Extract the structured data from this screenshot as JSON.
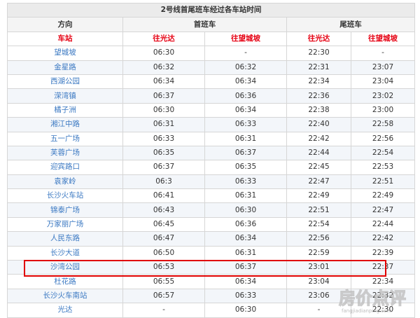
{
  "table": {
    "title": "2号线首尾班车经过各车站时间",
    "col_direction": "方向",
    "first_train": "首班车",
    "last_train": "尾班车",
    "col_station": "车站",
    "to_guangda": "往光达",
    "to_wangli": "往望城坡",
    "rows": [
      {
        "station": "望城坡",
        "first_guangda": "06:30",
        "first_wangli": "-",
        "last_guangda": "22:30",
        "last_wangli": "-"
      },
      {
        "station": "金星路",
        "first_guangda": "06:32",
        "first_wangli": "06:32",
        "last_guangda": "22:31",
        "last_wangli": "23:07"
      },
      {
        "station": "西湖公园",
        "first_guangda": "06:34",
        "first_wangli": "06:34",
        "last_guangda": "22:34",
        "last_wangli": "23:04"
      },
      {
        "station": "溁湾镇",
        "first_guangda": "06:37",
        "first_wangli": "06:36",
        "last_guangda": "22:36",
        "last_wangli": "23:02"
      },
      {
        "station": "橘子洲",
        "first_guangda": "06:30",
        "first_wangli": "06:34",
        "last_guangda": "22:38",
        "last_wangli": "23:00"
      },
      {
        "station": "湘江中路",
        "first_guangda": "06:31",
        "first_wangli": "06:33",
        "last_guangda": "22:40",
        "last_wangli": "22:58"
      },
      {
        "station": "五一广场",
        "first_guangda": "06:33",
        "first_wangli": "06:31",
        "last_guangda": "22:42",
        "last_wangli": "22:56"
      },
      {
        "station": "芙蓉广场",
        "first_guangda": "06:35",
        "first_wangli": "06:37",
        "last_guangda": "22:44",
        "last_wangli": "22:54"
      },
      {
        "station": "迎宾路口",
        "first_guangda": "06:37",
        "first_wangli": "06:35",
        "last_guangda": "22:45",
        "last_wangli": "22:53"
      },
      {
        "station": "袁家岭",
        "first_guangda": "06:3",
        "first_wangli": "06:33",
        "last_guangda": "22:47",
        "last_wangli": "22:51"
      },
      {
        "station": "长沙火车站",
        "first_guangda": "06:41",
        "first_wangli": "06:31",
        "last_guangda": "22:49",
        "last_wangli": "22:49"
      },
      {
        "station": "锦泰广场",
        "first_guangda": "06:43",
        "first_wangli": "06:30",
        "last_guangda": "22:51",
        "last_wangli": "22:47"
      },
      {
        "station": "万家丽广场",
        "first_guangda": "06:45",
        "first_wangli": "06:36",
        "last_guangda": "22:54",
        "last_wangli": "22:44"
      },
      {
        "station": "人民东路",
        "first_guangda": "06:47",
        "first_wangli": "06:34",
        "last_guangda": "22:56",
        "last_wangli": "22:42"
      },
      {
        "station": "长沙大道",
        "first_guangda": "06:50",
        "first_wangli": "06:31",
        "last_guangda": "22:59",
        "last_wangli": "22:39"
      },
      {
        "station": "沙湾公园",
        "first_guangda": "06:53",
        "first_wangli": "06:37",
        "last_guangda": "23:01",
        "last_wangli": "22:37"
      },
      {
        "station": "杜花路",
        "first_guangda": "06:55",
        "first_wangli": "06:34",
        "last_guangda": "23:04",
        "last_wangli": "22:34"
      },
      {
        "station": "长沙火车南站",
        "first_guangda": "06:57",
        "first_wangli": "06:33",
        "last_guangda": "23:06",
        "last_wangli": "22:32"
      },
      {
        "station": "光达",
        "first_guangda": "-",
        "first_wangli": "06:30",
        "last_guangda": "-",
        "last_wangli": "22:30"
      }
    ]
  },
  "watermark": {
    "text": "房价点评",
    "subtext": "fangjiadianping.com"
  },
  "colors": {
    "header_red": "#e60012",
    "station_blue": "#3a78c2",
    "highlight_red": "#e00000"
  }
}
